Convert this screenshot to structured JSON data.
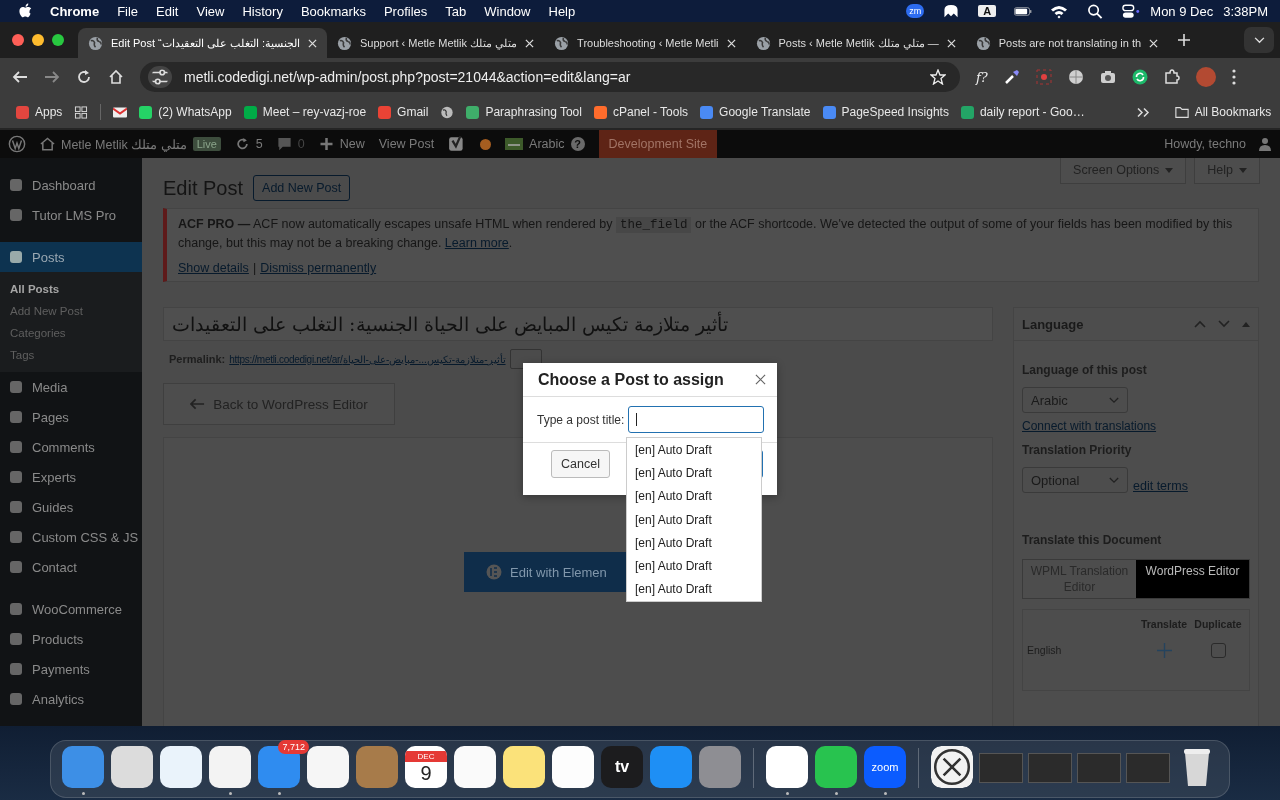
{
  "menu_bar": {
    "app": "Chrome",
    "items": [
      "File",
      "Edit",
      "View",
      "History",
      "Bookmarks",
      "Profiles",
      "Tab",
      "Window",
      "Help"
    ],
    "zoom_badge": "zm",
    "input_source": "A",
    "date": "Mon 9 Dec",
    "time": "3:38PM"
  },
  "tabs": [
    {
      "title": "Edit Post “الجنسية: التغلب على التعقيدات",
      "selected": true
    },
    {
      "title": "Support ‹ Metle Metlik متلي متلك",
      "selected": false
    },
    {
      "title": "Troubleshooting ‹ Metle Metli",
      "selected": false
    },
    {
      "title": "Posts ‹ Metle Metlik متلي متلك —",
      "selected": false
    },
    {
      "title": "Posts are not translating in th",
      "selected": false
    }
  ],
  "toolbar": {
    "url": "metli.codedigi.net/wp-admin/post.php?post=21044&action=edit&lang=ar",
    "extension_label": "f?"
  },
  "bookmarks": [
    {
      "label": "Apps",
      "color": "#e2463f"
    },
    {
      "label": "(2) WhatsApp",
      "color": "#25d366"
    },
    {
      "label": "Meet – rey-vazj-roe",
      "color": "#00ac47"
    },
    {
      "label": "Gmail",
      "color": "#ea4335"
    },
    {
      "label": "Paraphrasing Tool",
      "color": "#3fae6a"
    },
    {
      "label": "cPanel - Tools",
      "color": "#ff6c2c"
    },
    {
      "label": "Google Translate",
      "color": "#4a8af4"
    },
    {
      "label": "PageSpeed Insights",
      "color": "#4a8af4"
    },
    {
      "label": "daily report - Goo…",
      "color": "#23a566"
    }
  ],
  "all_bookmarks": "All Bookmarks",
  "admin_bar": {
    "site": "Metle Metlik متلي متلك",
    "live": "Live",
    "updates": "5",
    "comments": "0",
    "new": "New",
    "view_post": "View Post",
    "language": "Arabic",
    "help_mark": "?",
    "dev_site": "Development Site",
    "howdy": "Howdy, techno"
  },
  "sidebar": [
    [
      {
        "label": "Dashboard",
        "selected": false
      },
      {
        "label": "Tutor LMS Pro",
        "selected": false
      }
    ],
    [
      {
        "label": "Posts",
        "selected": true,
        "children": [
          {
            "label": "All Posts",
            "selected": true
          },
          {
            "label": "Add New Post",
            "selected": false
          },
          {
            "label": "Categories",
            "selected": false
          },
          {
            "label": "Tags",
            "selected": false
          }
        ]
      },
      {
        "label": "Media",
        "selected": false
      },
      {
        "label": "Pages",
        "selected": false
      },
      {
        "label": "Comments",
        "selected": false
      },
      {
        "label": "Experts",
        "selected": false
      },
      {
        "label": "Guides",
        "selected": false
      },
      {
        "label": "Custom CSS & JS",
        "selected": false
      },
      {
        "label": "Contact",
        "selected": false
      }
    ],
    [
      {
        "label": "WooCommerce",
        "selected": false
      },
      {
        "label": "Products",
        "selected": false
      },
      {
        "label": "Payments",
        "selected": false
      },
      {
        "label": "Analytics",
        "selected": false
      }
    ]
  ],
  "page": {
    "title": "Edit Post",
    "add_new": "Add New Post",
    "screen_options": "Screen Options",
    "help": "Help"
  },
  "notice": {
    "before": "**ACF PRO —** ACF now automatically escapes unsafe HTML when rendered by",
    "code": "the_field",
    "after": "or the ACF shortcode. We've detected the output of some of your fields has been modified by this change, but this may not be a breaking change.",
    "learn_more": "Learn more",
    "end": ".",
    "show_details": "Show details",
    "separator": "|",
    "dismiss": "Dismiss permanently"
  },
  "post": {
    "title": "تأثير متلازمة تكيس المبايض على الحياة الجنسية: التغلب على التعقيدات",
    "permalink_label": "Permalink:",
    "permalink": "https://metli.codedigi.net/ar/تأثير-متلازمة-تكيس...-مبايض-على-الحياة",
    "back_button": "Back to WordPress Editor",
    "elementor_button": "Edit with Elemen"
  },
  "language_panel": {
    "title": "Language",
    "language_label": "Language of this post",
    "language": "Arabic",
    "connect": "Connect with translations",
    "priority_label": "Translation Priority",
    "priority": "Optional",
    "edit_terms": "edit terms",
    "translate_label": "Translate this Document",
    "editor_tabs": [
      {
        "label": "WPML Translation Editor",
        "selected": false
      },
      {
        "label": "WordPress Editor",
        "selected": true
      }
    ],
    "columns": [
      "Translate",
      "Duplicate"
    ],
    "rows": [
      {
        "language": "English",
        "duplicate": false
      }
    ]
  },
  "modal": {
    "title": "Choose a Post to assign",
    "field_label": "Type a post title:",
    "suggestions": [
      "[en] Auto Draft",
      "[en] Auto Draft",
      "[en] Auto Draft",
      "[en] Auto Draft",
      "[en] Auto Draft",
      "[en] Auto Draft",
      "[en] Auto Draft"
    ],
    "cancel": "Cancel"
  },
  "dock": {
    "mail_badge": "7,712",
    "calendar_month": "DEC",
    "calendar_day": "9",
    "tv_label": "tv",
    "zoom_label": "zoom"
  }
}
